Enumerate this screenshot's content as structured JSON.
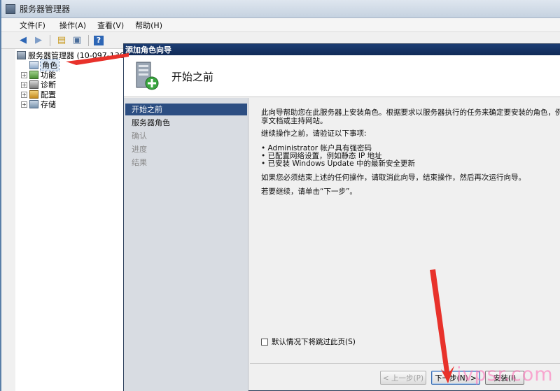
{
  "window": {
    "title": "服务器管理器"
  },
  "menu": {
    "items": [
      "文件(F)",
      "操作(A)",
      "查看(V)",
      "帮助(H)"
    ]
  },
  "toolbar": {
    "icons": [
      "back-icon",
      "forward-icon",
      "up-folder-icon",
      "console-tree-icon",
      "help-icon"
    ]
  },
  "tree": {
    "root": "服务器管理器 (10-097-136-",
    "items": [
      "角色",
      "功能",
      "诊断",
      "配置",
      "存储"
    ]
  },
  "wizard": {
    "window_title": "添加角色向导",
    "header_title": "开始之前",
    "steps": [
      "开始之前",
      "服务器角色",
      "确认",
      "进度",
      "结果"
    ],
    "content": {
      "intro_line1": "此向导帮助您在此服务器上安装角色。根据要求以服务器执行的任务来确定要安装的角色，例",
      "intro_line2": "享文档或主持网站。",
      "verify_heading": "继续操作之前，请验证以下事项:",
      "bullet1": "• Administrator 帐户具有强密码",
      "bullet2": "• 已配置网络设置，例如静态 IP 地址",
      "bullet3": "• 已安装 Windows Update 中的最新安全更新",
      "cancel_note": "如果您必须结束上述的任何操作，请取消此向导，结束操作，然后再次运行向导。",
      "continue_note": "若要继续，请单击“下一步”。"
    },
    "skip_label": "默认情况下将跳过此页(S)",
    "buttons": {
      "prev": "< 上一步(P)",
      "next": "下一步(N) >",
      "install": "安装(I)"
    }
  },
  "watermark": "ivpsr.com",
  "colors": {
    "arrow": "#e8322b",
    "active_step": "#2c4e82",
    "wizard_titlebar": "#1c3d73"
  }
}
